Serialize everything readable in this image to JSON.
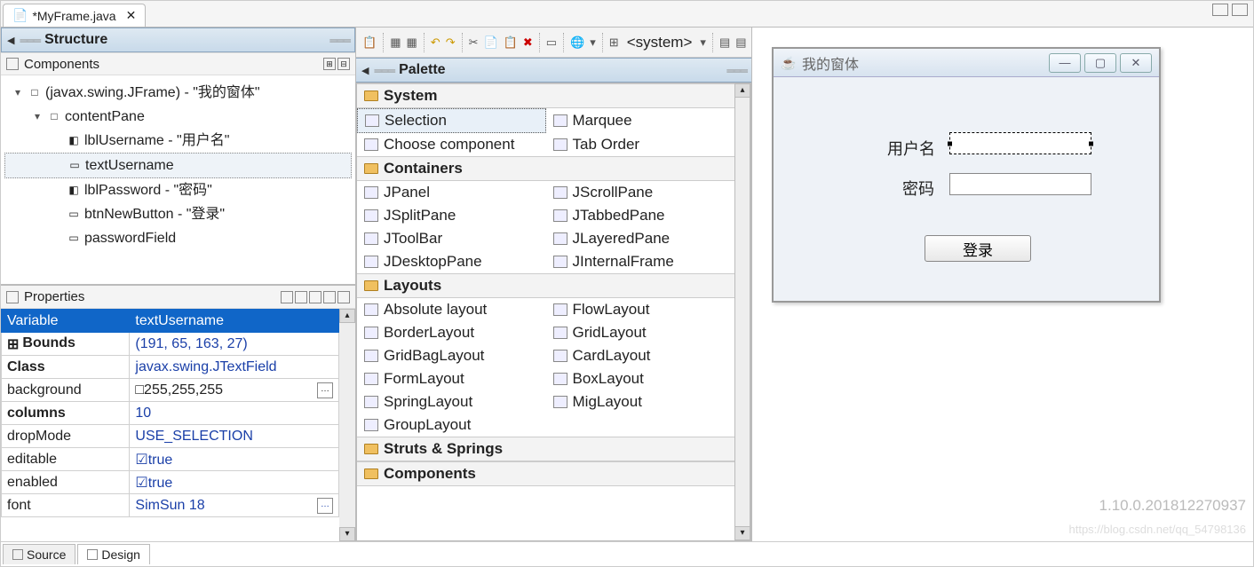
{
  "editor_tab": "*MyFrame.java",
  "structure": {
    "title": "Structure",
    "components_label": "Components",
    "tree": [
      {
        "indent": 0,
        "twisty": "▾",
        "icon": "□",
        "text": "(javax.swing.JFrame) - \"我的窗体\""
      },
      {
        "indent": 1,
        "twisty": "▾",
        "icon": "□",
        "text": "contentPane"
      },
      {
        "indent": 2,
        "twisty": "",
        "icon": "◧",
        "text": "lblUsername - \"用户名\""
      },
      {
        "indent": 2,
        "twisty": "",
        "icon": "▭",
        "text": "textUsername",
        "selected": true
      },
      {
        "indent": 2,
        "twisty": "",
        "icon": "◧",
        "text": "lblPassword - \"密码\""
      },
      {
        "indent": 2,
        "twisty": "",
        "icon": "▭",
        "text": "btnNewButton - \"登录\""
      },
      {
        "indent": 2,
        "twisty": "",
        "icon": "▭",
        "text": "passwordField"
      }
    ]
  },
  "properties": {
    "title": "Properties",
    "rows": [
      {
        "name": "Variable",
        "name_bold": false,
        "value": "textUsername",
        "selected": true
      },
      {
        "name": "Bounds",
        "name_bold": true,
        "value": "(191, 65, 163, 27)",
        "blue": true,
        "expand": "⊞"
      },
      {
        "name": "Class",
        "name_bold": true,
        "value": "javax.swing.JTextField",
        "blue": true
      },
      {
        "name": "background",
        "value": "□255,255,255",
        "ellipsis": true
      },
      {
        "name": "columns",
        "name_bold": true,
        "value": "10",
        "blue": true
      },
      {
        "name": "dropMode",
        "value": "USE_SELECTION",
        "blue": true
      },
      {
        "name": "editable",
        "value": "☑true",
        "blue": true
      },
      {
        "name": "enabled",
        "value": "☑true",
        "blue": true
      },
      {
        "name": "font",
        "value": "SimSun 18",
        "blue": true,
        "ellipsis": true
      }
    ]
  },
  "palette": {
    "title": "Palette",
    "categories": [
      {
        "name": "System",
        "items": [
          [
            "Selection",
            "Marquee"
          ],
          [
            "Choose component",
            "Tab Order"
          ]
        ],
        "selected_item": "Selection"
      },
      {
        "name": "Containers",
        "items": [
          [
            "JPanel",
            "JScrollPane"
          ],
          [
            "JSplitPane",
            "JTabbedPane"
          ],
          [
            "JToolBar",
            "JLayeredPane"
          ],
          [
            "JDesktopPane",
            "JInternalFrame"
          ]
        ]
      },
      {
        "name": "Layouts",
        "items": [
          [
            "Absolute layout",
            "FlowLayout"
          ],
          [
            "BorderLayout",
            "GridLayout"
          ],
          [
            "GridBagLayout",
            "CardLayout"
          ],
          [
            "FormLayout",
            "BoxLayout"
          ],
          [
            "SpringLayout",
            "MigLayout"
          ],
          [
            "GroupLayout",
            ""
          ]
        ]
      },
      {
        "name": "Struts & Springs",
        "items": []
      },
      {
        "name": "Components",
        "items": []
      }
    ]
  },
  "toolbar": {
    "system_dropdown": "<system>"
  },
  "designer": {
    "frame_title": "我的窗体",
    "lbl_username": "用户名",
    "lbl_password": "密码",
    "btn_login": "登录"
  },
  "footer": {
    "source": "Source",
    "design": "Design"
  },
  "version": "1.10.0.201812270937",
  "watermark": "https://blog.csdn.net/qq_54798136"
}
